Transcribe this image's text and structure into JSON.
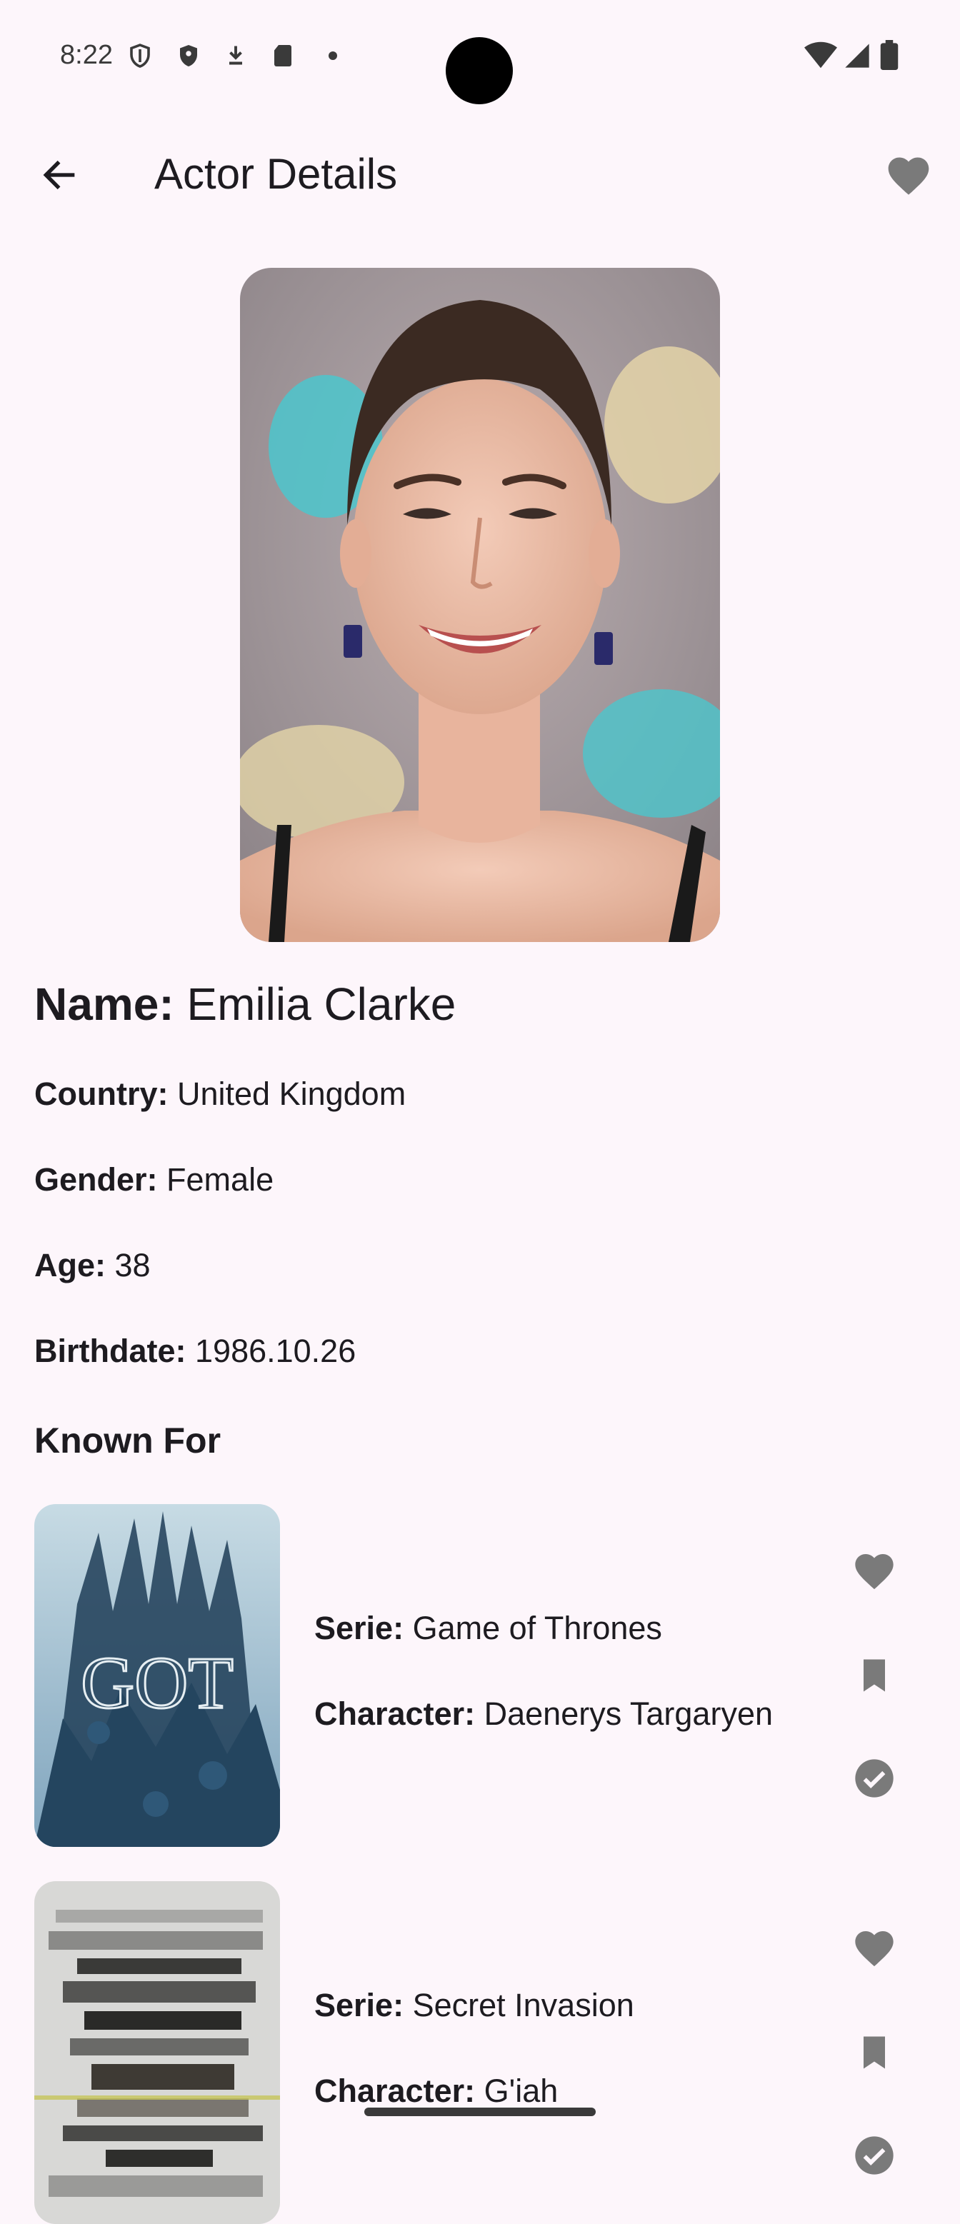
{
  "status_bar": {
    "time": "8:22"
  },
  "app_bar": {
    "title": "Actor Details"
  },
  "actor": {
    "name_label": "Name:",
    "name": "Emilia Clarke",
    "country_label": "Country:",
    "country": "United Kingdom",
    "gender_label": "Gender:",
    "gender": "Female",
    "age_label": "Age:",
    "age": "38",
    "birthdate_label": "Birthdate:",
    "birthdate": "1986.10.26"
  },
  "known_for": {
    "title": "Known For",
    "items": [
      {
        "serie_label": "Serie:",
        "serie": "Game of Thrones",
        "character_label": "Character:",
        "character": "Daenerys Targaryen",
        "poster_text": "GOT"
      },
      {
        "serie_label": "Serie:",
        "serie": "Secret Invasion",
        "character_label": "Character:",
        "character": "G'iah"
      }
    ]
  },
  "colors": {
    "background": "#fdf6fb",
    "icon_gray": "#7a7a7a",
    "text": "#1d1b20"
  },
  "icons": [
    "back-arrow-icon",
    "heart-icon",
    "bookmark-icon",
    "check-circle-icon"
  ]
}
